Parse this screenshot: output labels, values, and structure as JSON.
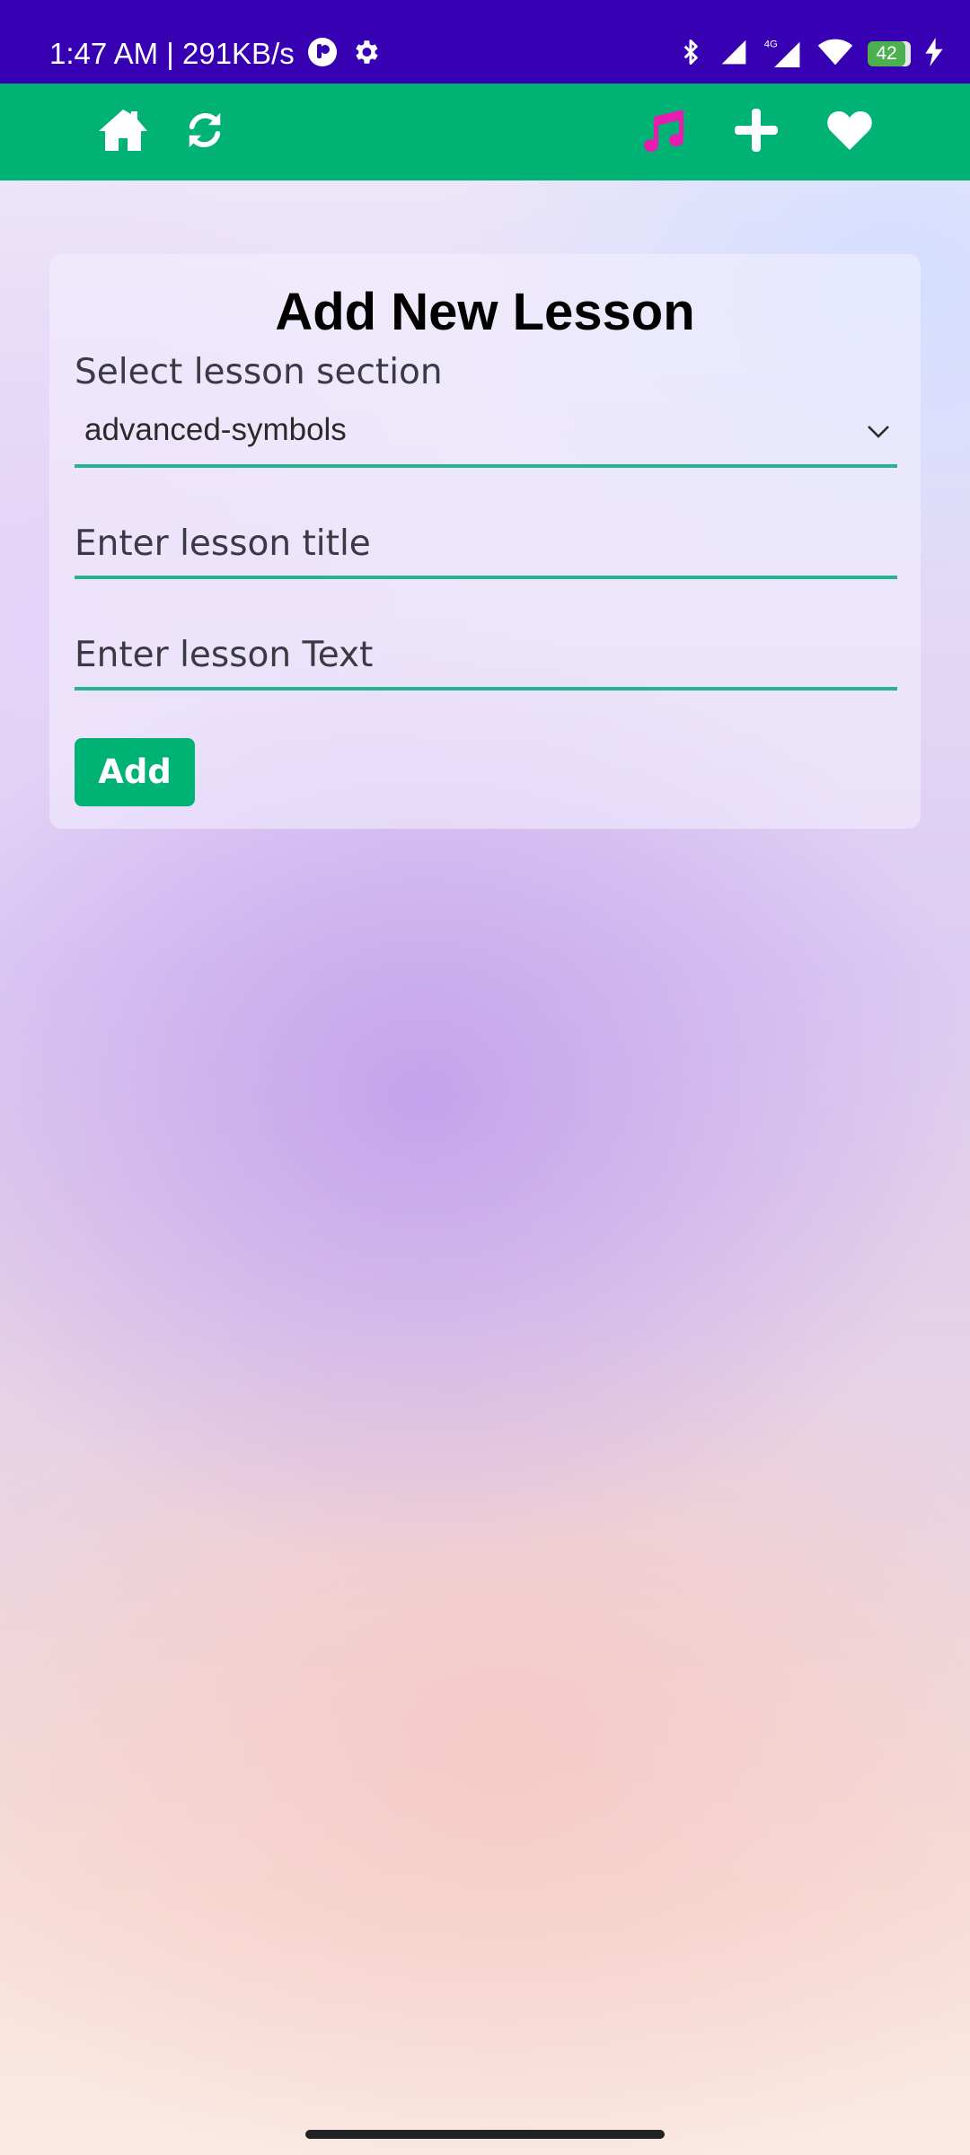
{
  "status_bar": {
    "time_speed": "1:47 AM | 291KB/s",
    "network_label": "4G",
    "battery_level": "42",
    "background_color": "#3700b3"
  },
  "nav": {
    "background_color": "#00b273",
    "active_icon_color": "#e81cb0",
    "icons": [
      "home-icon",
      "refresh-icon",
      "music-note-icon",
      "plus-icon",
      "heart-icon"
    ]
  },
  "form": {
    "title": "Add New Lesson",
    "section_label": "Select lesson section",
    "section_selected": "advanced-symbols",
    "title_placeholder": "Enter lesson title",
    "text_placeholder": "Enter lesson Text",
    "submit_label": "Add",
    "accent_color": "#26b38f"
  }
}
